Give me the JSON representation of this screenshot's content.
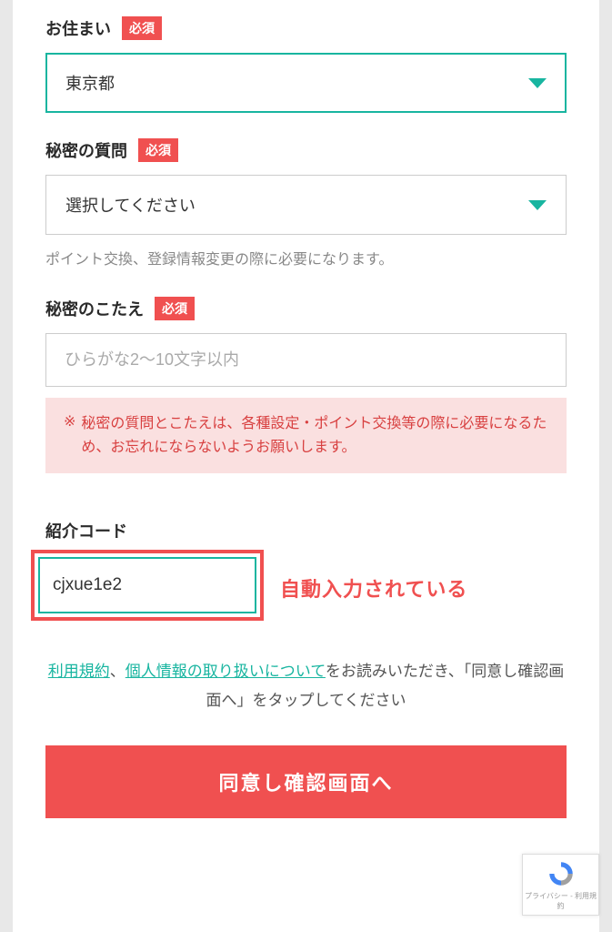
{
  "required_badge": "必須",
  "residence": {
    "label": "お住まい",
    "value": "東京都"
  },
  "secret_question": {
    "label": "秘密の質問",
    "placeholder": "選択してください",
    "helper": "ポイント交換、登録情報変更の際に必要になります。"
  },
  "secret_answer": {
    "label": "秘密のこたえ",
    "placeholder": "ひらがな2〜10文字以内",
    "warning_marker": "※",
    "warning": "秘密の質問とこたえは、各種設定・ポイント交換等の際に必要になるため、お忘れにならないようお願いします。"
  },
  "referral": {
    "label": "紹介コード",
    "value": "cjxue1e2",
    "annotation": "自動入力されている"
  },
  "terms": {
    "link1": "利用規約",
    "separator": "、",
    "link2": "個人情報の取り扱いについて",
    "suffix1": "をお読みいただき、「同意し確認画面へ」をタップしてください"
  },
  "submit_label": "同意し確認画面へ",
  "recaptcha": {
    "footer": "プライバシー - 利用規約"
  }
}
